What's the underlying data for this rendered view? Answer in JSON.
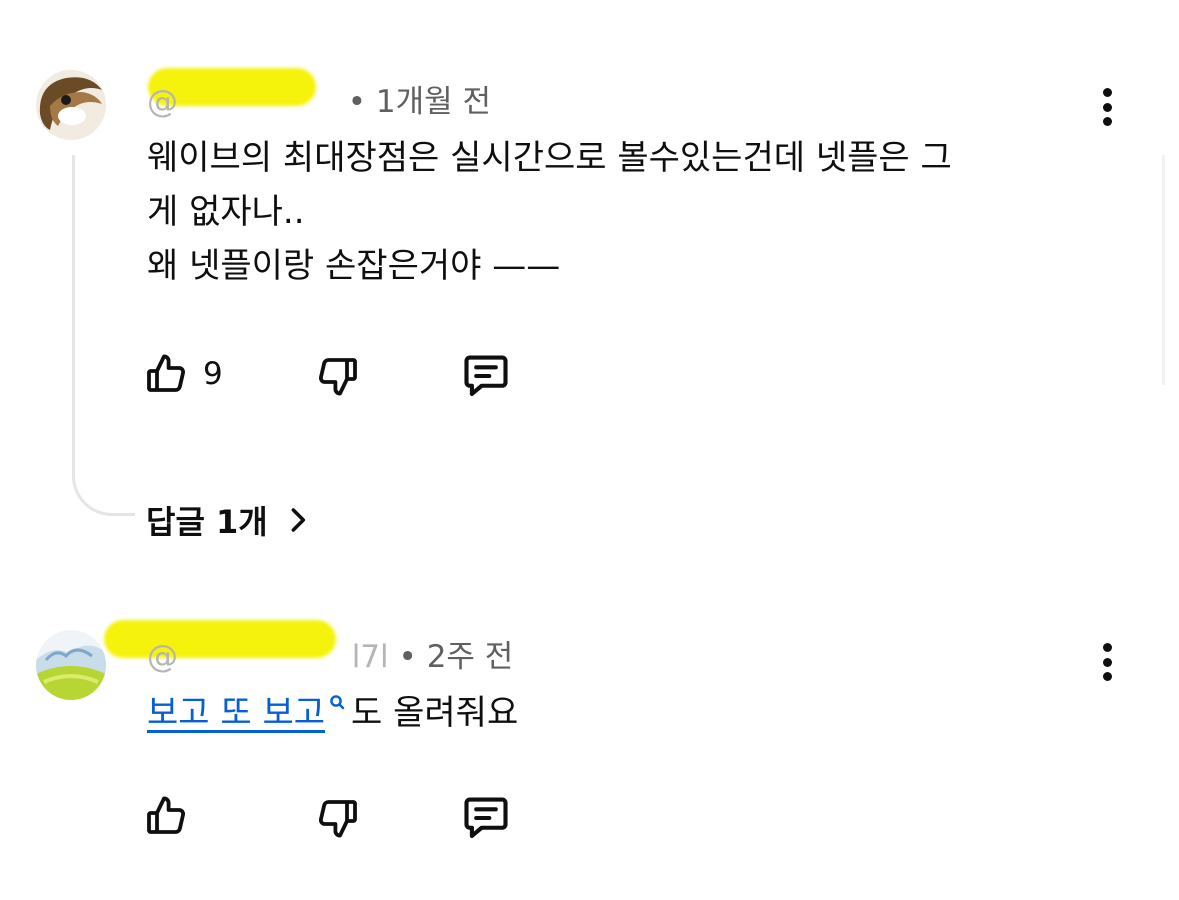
{
  "comments": [
    {
      "handle_visible": "@",
      "time": "1개월 전",
      "lines": [
        "웨이브의 최대장점은 실시간으로 볼수있는건데 넷플은 그",
        "게 없자나..",
        "왜 넷플이랑 손잡은거야 ——"
      ],
      "likes": "9",
      "replies_label": "답글 1개"
    },
    {
      "handle_visible_start": "@",
      "handle_visible_end": "l7l",
      "time": "2주 전",
      "link_text": "보고 또 보고",
      "text_after_link": "도 올려줘요"
    }
  ],
  "separator": "•",
  "icons": {
    "like": "thumb-up-icon",
    "dislike": "thumb-down-icon",
    "reply": "reply-comment-icon",
    "more": "more-vert-icon",
    "chevron": "chevron-right-icon",
    "search": "search-icon"
  },
  "colors": {
    "text": "#0f0f0f",
    "meta": "#606060",
    "link": "#065fd4",
    "redaction": "#f5f200"
  }
}
